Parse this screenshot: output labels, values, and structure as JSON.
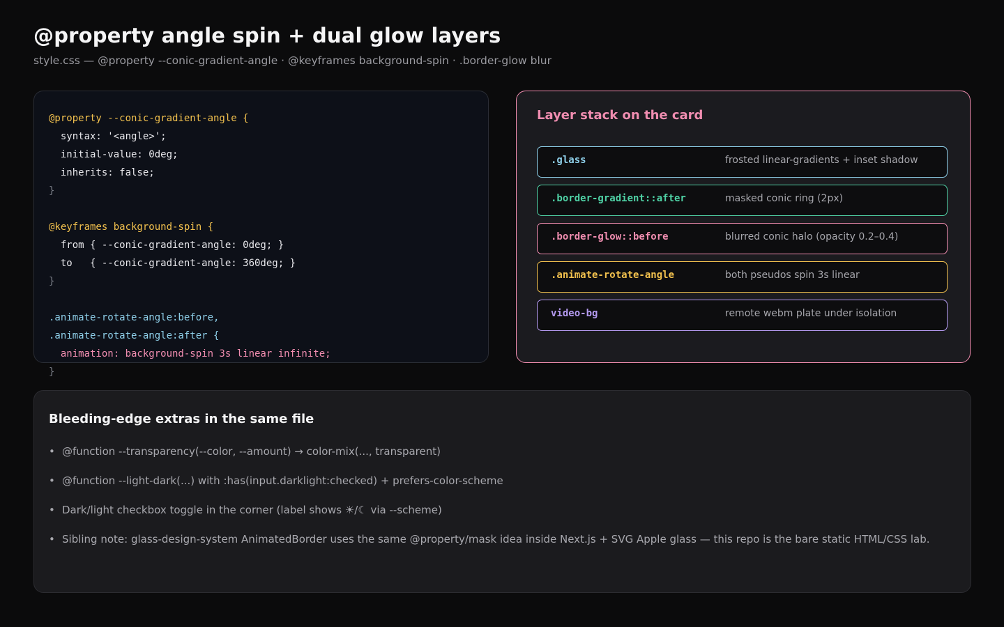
{
  "header": {
    "title": "@property angle spin + dual glow layers",
    "subtitle": "style.css — @property --conic-gradient-angle · @keyframes background-spin · .border-glow blur"
  },
  "code_panel": {
    "lines": [
      {
        "text": "@property --conic-gradient-angle {",
        "color": "#f2c14e"
      },
      {
        "text": "  syntax: '<angle>';",
        "color": "#e8e8ec"
      },
      {
        "text": "  initial-value: 0deg;",
        "color": "#e8e8ec"
      },
      {
        "text": "  inherits: false;",
        "color": "#e8e8ec"
      },
      {
        "text": "}",
        "color": "#7b7f88"
      },
      {
        "text": "",
        "color": "#e8e8ec"
      },
      {
        "text": "@keyframes background-spin {",
        "color": "#f2c14e"
      },
      {
        "text": "  from { --conic-gradient-angle: 0deg; }",
        "color": "#e8e8ec"
      },
      {
        "text": "  to   { --conic-gradient-angle: 360deg; }",
        "color": "#e8e8ec"
      },
      {
        "text": "}",
        "color": "#7b7f88"
      },
      {
        "text": "",
        "color": "#e8e8ec"
      },
      {
        "text": ".animate-rotate-angle:before,",
        "color": "#8fd0ea"
      },
      {
        "text": ".animate-rotate-angle:after {",
        "color": "#8fd0ea"
      },
      {
        "text": "  animation: background-spin 3s linear infinite;",
        "color": "#f08db0"
      },
      {
        "text": "}",
        "color": "#7b7f88"
      }
    ]
  },
  "layers_panel": {
    "title": "Layer stack on the card",
    "rows": [
      {
        "name": ".glass",
        "description": "frosted linear-gradients + inset shadow",
        "color": "#8fd0ea"
      },
      {
        "name": ".border-gradient::after",
        "description": "masked conic ring (2px)",
        "color": "#4fd1a5"
      },
      {
        "name": ".border-glow::before",
        "description": "blurred conic halo (opacity 0.2–0.4)",
        "color": "#f08db0"
      },
      {
        "name": ".animate-rotate-angle",
        "description": "both pseudos spin 3s linear",
        "color": "#f2c14e"
      },
      {
        "name": "video-bg",
        "description": "remote webm plate under isolation",
        "color": "#b49af0"
      }
    ]
  },
  "extras_panel": {
    "title": "Bleeding-edge extras in the same file",
    "bullet": "•",
    "items": [
      "@function --transparency(--color, --amount) → color-mix(..., transparent)",
      "@function --light-dark(...) with :has(input.darklight:checked) + prefers-color-scheme",
      "Dark/light checkbox toggle in the corner (label shows ☀/☾ via --scheme)",
      "Sibling note: glass-design-system AnimatedBorder uses the same @property/mask idea inside Next.js + SVG Apple glass — this repo is the bare static HTML/CSS lab."
    ]
  }
}
